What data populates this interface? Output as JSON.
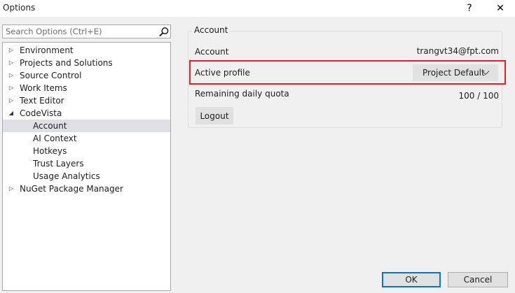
{
  "window": {
    "title": "Options",
    "help_glyph": "?",
    "close_glyph": "✕"
  },
  "search": {
    "placeholder": "Search Options (Ctrl+E)",
    "value": "",
    "icon": "search-icon"
  },
  "tree": {
    "items": [
      {
        "label": "Environment",
        "expander": "▷"
      },
      {
        "label": "Projects and Solutions",
        "expander": "▷"
      },
      {
        "label": "Source Control",
        "expander": "▷"
      },
      {
        "label": "Work Items",
        "expander": "▷"
      },
      {
        "label": "Text Editor",
        "expander": "▷"
      },
      {
        "label": "CodeVista",
        "expander": "◢"
      },
      {
        "label": "Account",
        "expander": ""
      },
      {
        "label": "AI Context",
        "expander": ""
      },
      {
        "label": "Hotkeys",
        "expander": ""
      },
      {
        "label": "Trust Layers",
        "expander": ""
      },
      {
        "label": "Usage Analytics",
        "expander": ""
      },
      {
        "label": "NuGet Package Manager",
        "expander": "▷"
      }
    ],
    "selected": "Account"
  },
  "account": {
    "group_title": "Account",
    "account_label": "Account",
    "account_value": "trangvt34@fpt.com",
    "profile_label": "Active profile",
    "profile_value": "Project Default",
    "quota_label": "Remaining daily quota",
    "quota_value": "100 / 100",
    "logout_label": "Logout"
  },
  "footer": {
    "ok_label": "OK",
    "cancel_label": "Cancel"
  },
  "colors": {
    "highlight_border": "#e8202a",
    "default_button_border": "#0078d7",
    "selected_row": "#dfdfe6"
  }
}
